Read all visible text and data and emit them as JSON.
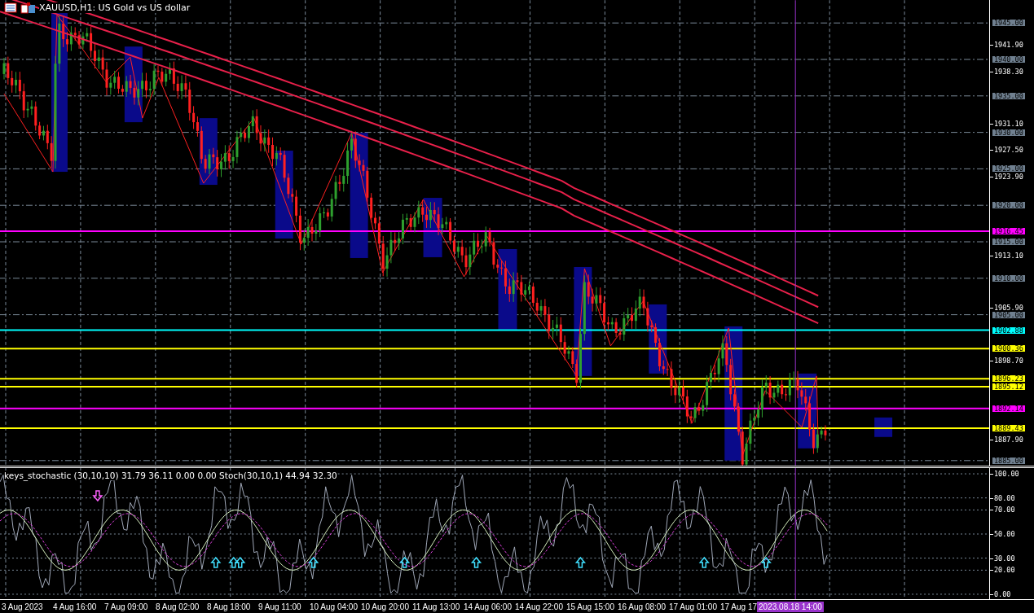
{
  "chart_title": "XAUUSD,H1: US Gold vs US dollar",
  "price_axis": [
    {
      "label": "1945.00",
      "kind": "grid"
    },
    {
      "label": "1941.90",
      "kind": "tick"
    },
    {
      "label": "1940.00",
      "kind": "grid"
    },
    {
      "label": "1938.30",
      "kind": "tick"
    },
    {
      "label": "1935.00",
      "kind": "grid"
    },
    {
      "label": "1931.10",
      "kind": "tick"
    },
    {
      "label": "1930.00",
      "kind": "grid"
    },
    {
      "label": "1927.50",
      "kind": "tick"
    },
    {
      "label": "1925.00",
      "kind": "grid"
    },
    {
      "label": "1923.90",
      "kind": "tick"
    },
    {
      "label": "1920.00",
      "kind": "grid"
    },
    {
      "label": "1915.00",
      "kind": "grid"
    },
    {
      "label": "1913.10",
      "kind": "tick"
    },
    {
      "label": "1910.00",
      "kind": "grid"
    },
    {
      "label": "1905.90",
      "kind": "tick"
    },
    {
      "label": "1905.00",
      "kind": "grid"
    },
    {
      "label": "1898.70",
      "kind": "tick"
    },
    {
      "label": "1887.90",
      "kind": "tick"
    },
    {
      "label": "1885.00",
      "kind": "grid"
    }
  ],
  "levels": [
    {
      "label": "1916.45",
      "color": "#ff00ff"
    },
    {
      "label": "1902.88",
      "color": "#00ffff"
    },
    {
      "label": "1900.36",
      "color": "#ffff00"
    },
    {
      "label": "1896.23",
      "color": "#ffff00"
    },
    {
      "label": "1895.12",
      "color": "#ffff00"
    },
    {
      "label": "1892.14",
      "color": "#ff00ff"
    },
    {
      "label": "1889.43",
      "color": "#ffff00"
    }
  ],
  "indicator": {
    "header": "keys_stochastic (30,10,10) 31.79 36.11 0.00 0.00 Stoch(30,10,1) 44.94 32.30",
    "axis": [
      "100.00",
      "80.00",
      "70.00",
      "50.00",
      "30.00",
      "20.00",
      "0.00"
    ]
  },
  "time_axis": [
    "3 Aug 2023",
    "4 Aug 16:00",
    "7 Aug 09:00",
    "8 Aug 02:00",
    "8 Aug 18:00",
    "9 Aug 11:00",
    "10 Aug 04:00",
    "10 Aug 20:00",
    "11 Aug 13:00",
    "14 Aug 06:00",
    "14 Aug 22:00",
    "15 Aug 15:00",
    "16 Aug 08:00",
    "17 Aug 01:00",
    "17 Aug 17"
  ],
  "cursor_time": "2023.08.18 14:00"
}
